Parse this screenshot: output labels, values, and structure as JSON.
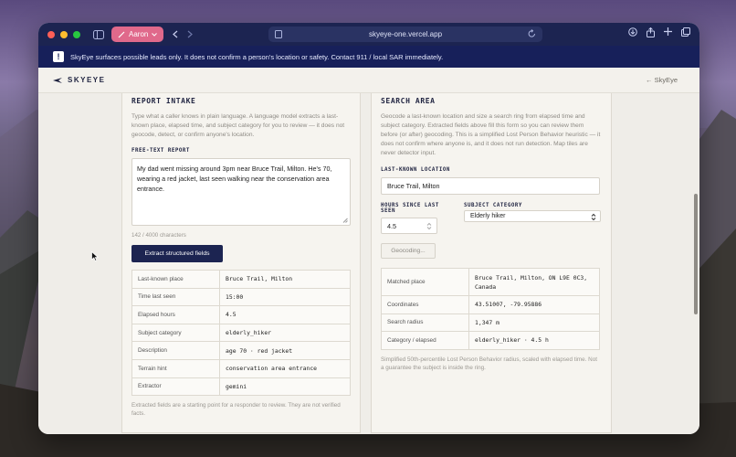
{
  "browser": {
    "profile_label": "Aaron",
    "url": "skyeye-one.vercel.app"
  },
  "banner": {
    "text": "SkyEye surfaces possible leads only. It does not confirm a person's location or safety. Contact 911 / local SAR immediately."
  },
  "header": {
    "app_name": "SKYEYE",
    "back_link": "← SkyEye"
  },
  "intake": {
    "title": "REPORT INTAKE",
    "description": "Type what a caller knows in plain language. A language model extracts a last-known place, elapsed time, and subject category for you to review — it does not geocode, detect, or confirm anyone's location.",
    "freetext_label": "FREE-TEXT REPORT",
    "report_text": "My dad went missing around 3pm near Bruce Trail, Milton. He's 70, wearing a red jacket, last seen walking near the conservation area entrance.",
    "char_count": "142 / 4000 characters",
    "extract_button": "Extract structured fields",
    "fields": [
      {
        "label": "Last-known place",
        "value": "Bruce Trail, Milton"
      },
      {
        "label": "Time last seen",
        "value": "15:00"
      },
      {
        "label": "Elapsed hours",
        "value": "4.5"
      },
      {
        "label": "Subject category",
        "value": "elderly_hiker"
      },
      {
        "label": "Description",
        "value": "age 70 · red jacket"
      },
      {
        "label": "Terrain hint",
        "value": "conservation area entrance"
      },
      {
        "label": "Extractor",
        "value": "gemini"
      }
    ],
    "footnote": "Extracted fields are a starting point for a responder to review. They are not verified facts."
  },
  "search": {
    "title": "SEARCH AREA",
    "description": "Geocode a last-known location and size a search ring from elapsed time and subject category. Extracted fields above fill this form so you can review them before (or after) geocoding. This is a simplified Lost Person Behavior heuristic — it does not confirm where anyone is, and it does not run detection. Map tiles are never detector input.",
    "location_label": "LAST-KNOWN LOCATION",
    "location_value": "Bruce Trail, Milton",
    "hours_label": "HOURS SINCE LAST SEEN",
    "hours_value": "4.5",
    "category_label": "SUBJECT CATEGORY",
    "category_value": "Elderly hiker",
    "geocode_button": "Geocoding...",
    "results": [
      {
        "label": "Matched place",
        "value": "Bruce Trail, Milton, ON L9E 0C3, Canada"
      },
      {
        "label": "Coordinates",
        "value": "43.51007, -79.95886"
      },
      {
        "label": "Search radius",
        "value": "1,347 m"
      },
      {
        "label": "Category / elapsed",
        "value": "elderly_hiker · 4.5 h"
      }
    ],
    "footnote": "Simplified 50th-percentile Lost Person Behavior radius, scaled with elapsed time. Not a guarantee the subject is inside the ring."
  }
}
